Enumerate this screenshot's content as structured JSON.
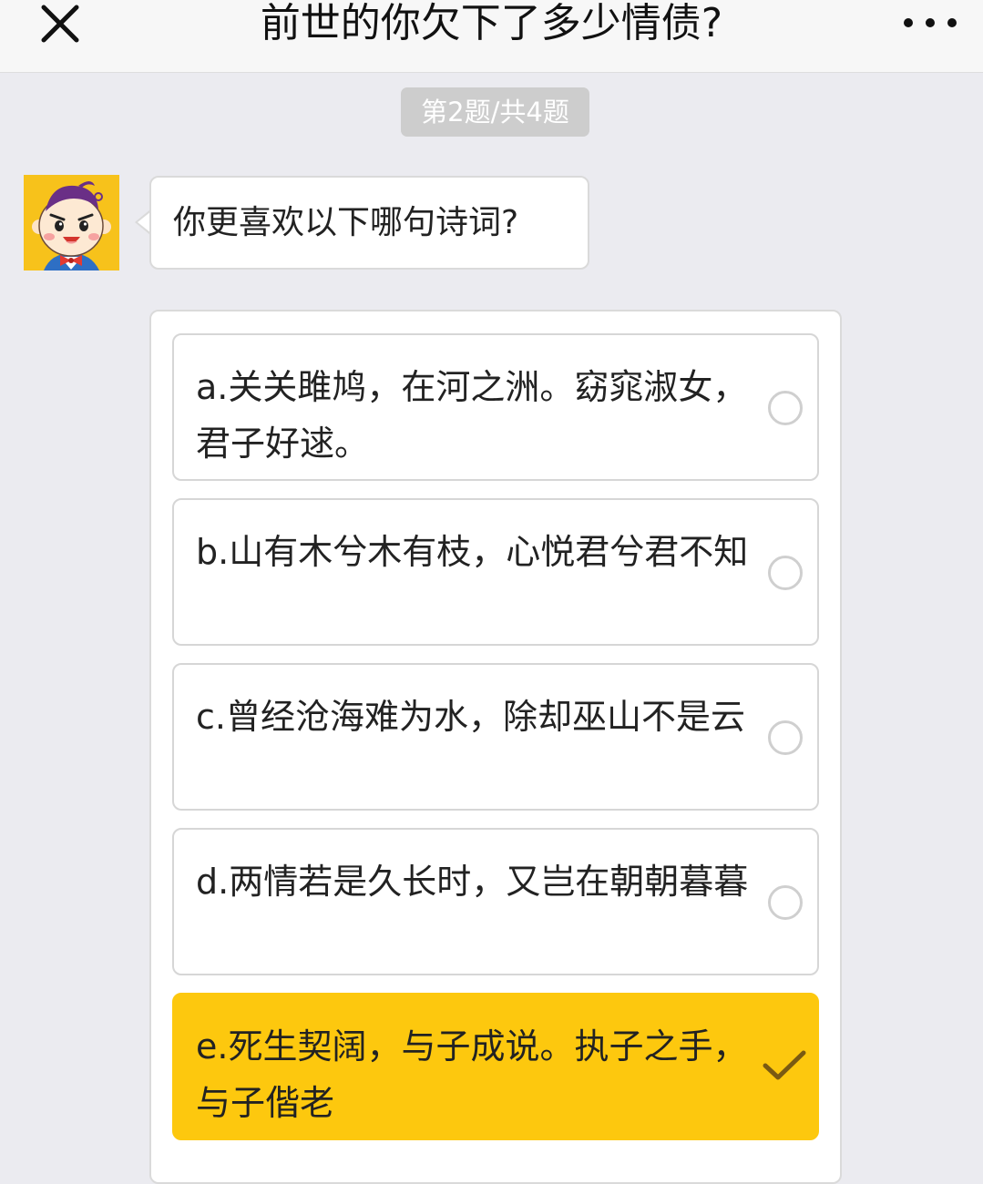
{
  "header": {
    "title": "前世的你欠下了多少情债?",
    "close_icon": "close-icon",
    "more_icon": "more-dots-icon"
  },
  "progress": {
    "label": "第2题/共4题"
  },
  "question": {
    "text": "你更喜欢以下哪句诗词?"
  },
  "options": [
    {
      "label": "a.关关雎鸠，在河之洲。窈窕淑女，君子好逑。",
      "selected": false
    },
    {
      "label": "b.山有木兮木有枝，心悦君兮君不知",
      "selected": false
    },
    {
      "label": "c.曾经沧海难为水，除却巫山不是云",
      "selected": false
    },
    {
      "label": "d.两情若是久长时，又岂在朝朝暮暮",
      "selected": false
    },
    {
      "label": "e.死生契阔，与子成说。执子之手，与子偕老",
      "selected": true
    }
  ],
  "colors": {
    "accent": "#fdc80e",
    "background": "#ebebf0",
    "avatar_bg": "#f7c21b",
    "check": "#7a5a12"
  }
}
